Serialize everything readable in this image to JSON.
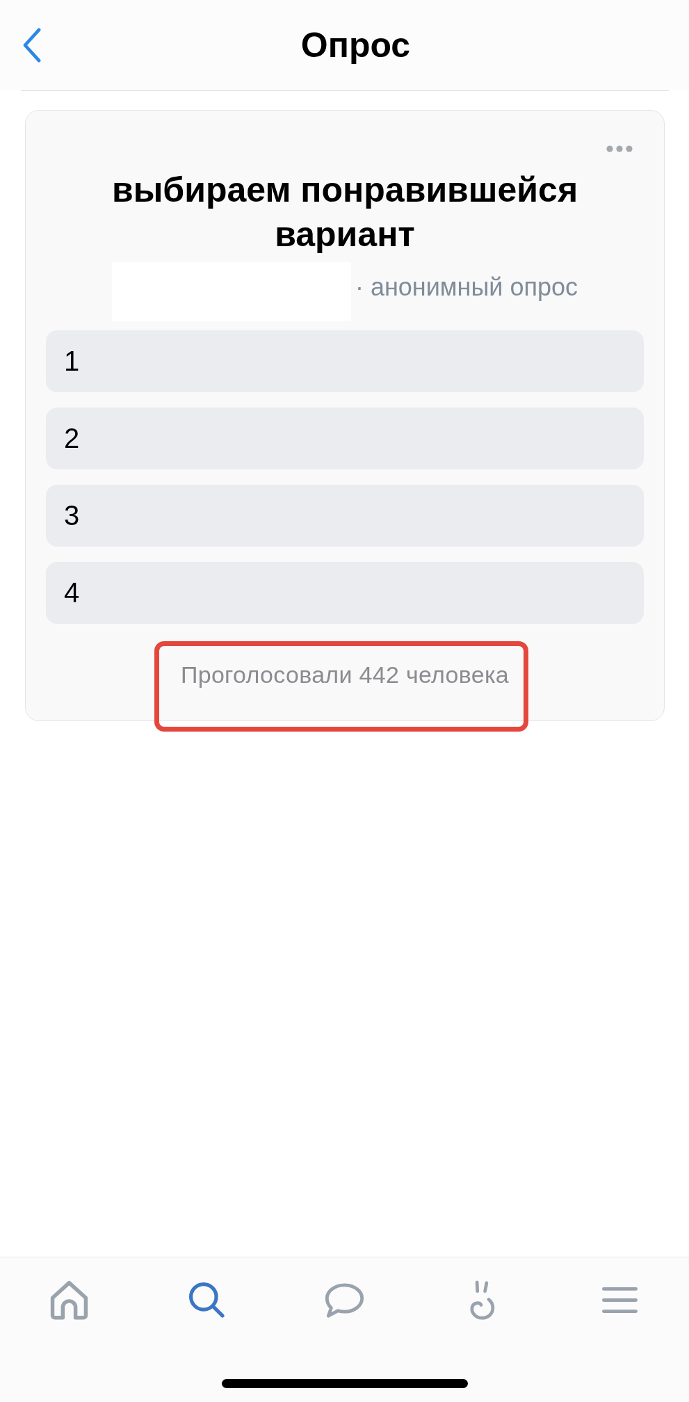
{
  "header": {
    "title": "Опрос"
  },
  "poll": {
    "question": "выбираем понравившейся вариант",
    "author_redacted": true,
    "meta": "· анонимный опрос",
    "options": [
      {
        "label": "1"
      },
      {
        "label": "2"
      },
      {
        "label": "3"
      },
      {
        "label": "4"
      }
    ],
    "votes": {
      "text": "Проголосовали 442 человека",
      "highlighted": true
    }
  },
  "tab_bar": {
    "items": [
      {
        "selected": false
      },
      {
        "selected": true
      },
      {
        "selected": false
      },
      {
        "selected": false
      },
      {
        "selected": false
      }
    ]
  }
}
